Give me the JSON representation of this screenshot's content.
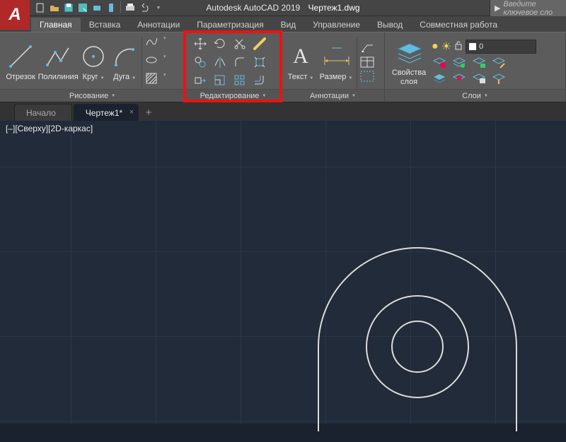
{
  "app": {
    "name": "Autodesk AutoCAD 2019",
    "file": "Чертеж1.dwg"
  },
  "search": {
    "placeholder": "Введите ключевое сло"
  },
  "tabs": [
    {
      "label": "Главная",
      "active": true
    },
    {
      "label": "Вставка"
    },
    {
      "label": "Аннотации"
    },
    {
      "label": "Параметризация"
    },
    {
      "label": "Вид"
    },
    {
      "label": "Управление"
    },
    {
      "label": "Вывод"
    },
    {
      "label": "Совместная работа"
    }
  ],
  "panels": {
    "draw": {
      "title": "Рисование",
      "items": [
        "Отрезок",
        "Полилиния",
        "Круг",
        "Дуга"
      ]
    },
    "edit": {
      "title": "Редактирование"
    },
    "annot": {
      "title": "Аннотации",
      "items": [
        "Текст",
        "Размер"
      ]
    },
    "layers": {
      "title": "Слои",
      "propLabel": "Свойства\nслоя",
      "current": "0"
    }
  },
  "doc_tabs": [
    {
      "label": "Начало"
    },
    {
      "label": "Чертеж1*",
      "active": true
    }
  ],
  "viewport_label": "[–][Сверху][2D-каркас]"
}
